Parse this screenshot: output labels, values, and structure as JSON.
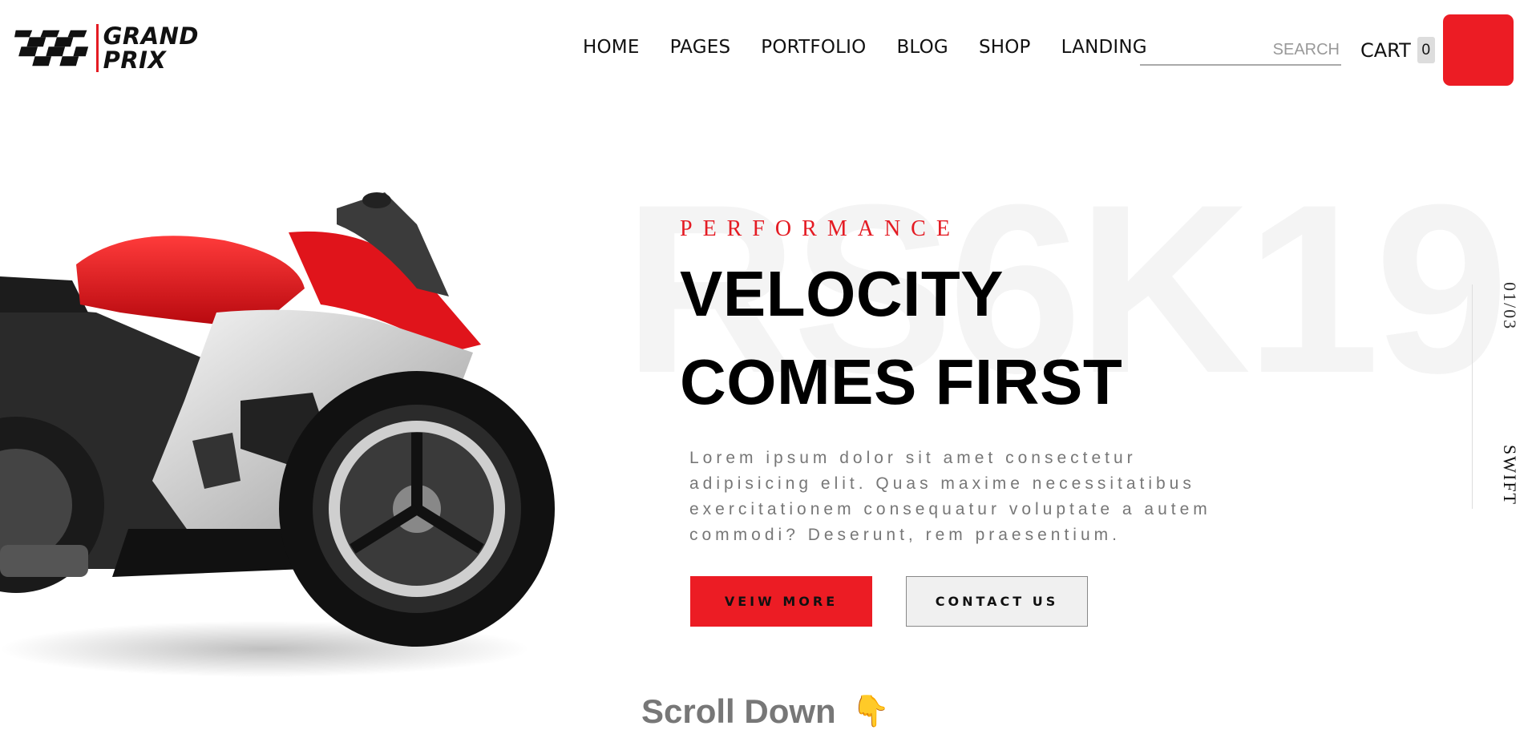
{
  "brand": {
    "line1": "GRAND",
    "line2": "PRIX"
  },
  "nav": [
    {
      "label": "HOME"
    },
    {
      "label": "PAGES"
    },
    {
      "label": "PORTFOLIO"
    },
    {
      "label": "BLOG"
    },
    {
      "label": "SHOP"
    },
    {
      "label": "LANDING"
    }
  ],
  "search": {
    "placeholder": "SEARCH"
  },
  "cart": {
    "label": "CART",
    "count": "0"
  },
  "hero": {
    "bg_text": "RS6K19",
    "eyebrow": "PERFORMANCE",
    "headline_line1": "VELOCITY",
    "headline_line2": "COMES FIRST",
    "description": "Lorem ipsum dolor sit amet consectetur adipisicing elit. Quas maxime necessitatibus exercitationem consequatur voluptate a autem commodi? Deserunt, rem praesentium.",
    "primary_button": "VEIW MORE",
    "secondary_button": "CONTACT US"
  },
  "slider": {
    "counter": "01/03",
    "word": "SWIFT"
  },
  "scroll": {
    "label": "Scroll Down",
    "icon": "pointing-down-hand-icon"
  },
  "colors": {
    "accent": "#ec1c24",
    "text": "#111111",
    "muted": "#777777"
  }
}
